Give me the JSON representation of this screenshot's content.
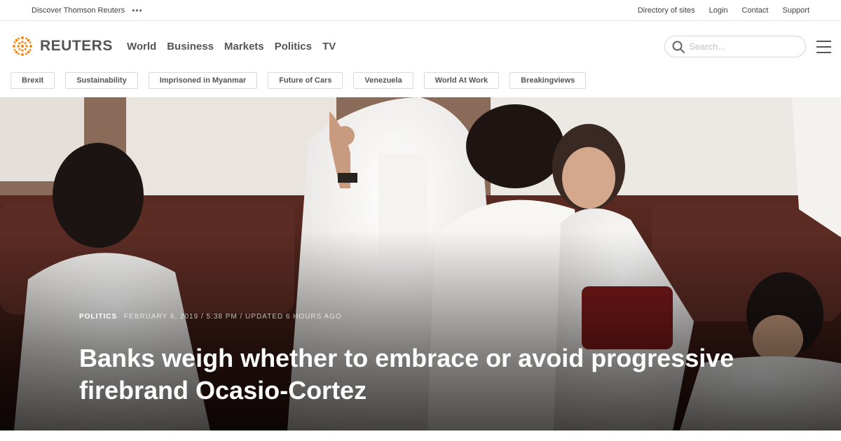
{
  "utility": {
    "discover_label": "Discover Thomson Reuters",
    "dots": "•••",
    "links": [
      "Directory of sites",
      "Login",
      "Contact",
      "Support"
    ]
  },
  "header": {
    "logo_text": "REUTERS",
    "brand_color": "#ff8000",
    "nav": [
      "World",
      "Business",
      "Markets",
      "Politics",
      "TV"
    ],
    "search_placeholder": "Search..."
  },
  "topics": [
    "Brexit",
    "Sustainability",
    "Imprisoned in Myanmar",
    "Future of Cars",
    "Venezuela",
    "World At Work",
    "Breakingviews"
  ],
  "article": {
    "section": "POLITICS",
    "dateline": "FEBRUARY 6, 2019 / 5:38 PM / UPDATED 6 HOURS AGO",
    "headline": "Banks weigh whether to embrace or avoid progressive firebrand Ocasio-Cortez"
  },
  "icons": {
    "search": "search-icon",
    "menu": "hamburger-menu-icon",
    "more": "more-dots-icon"
  }
}
